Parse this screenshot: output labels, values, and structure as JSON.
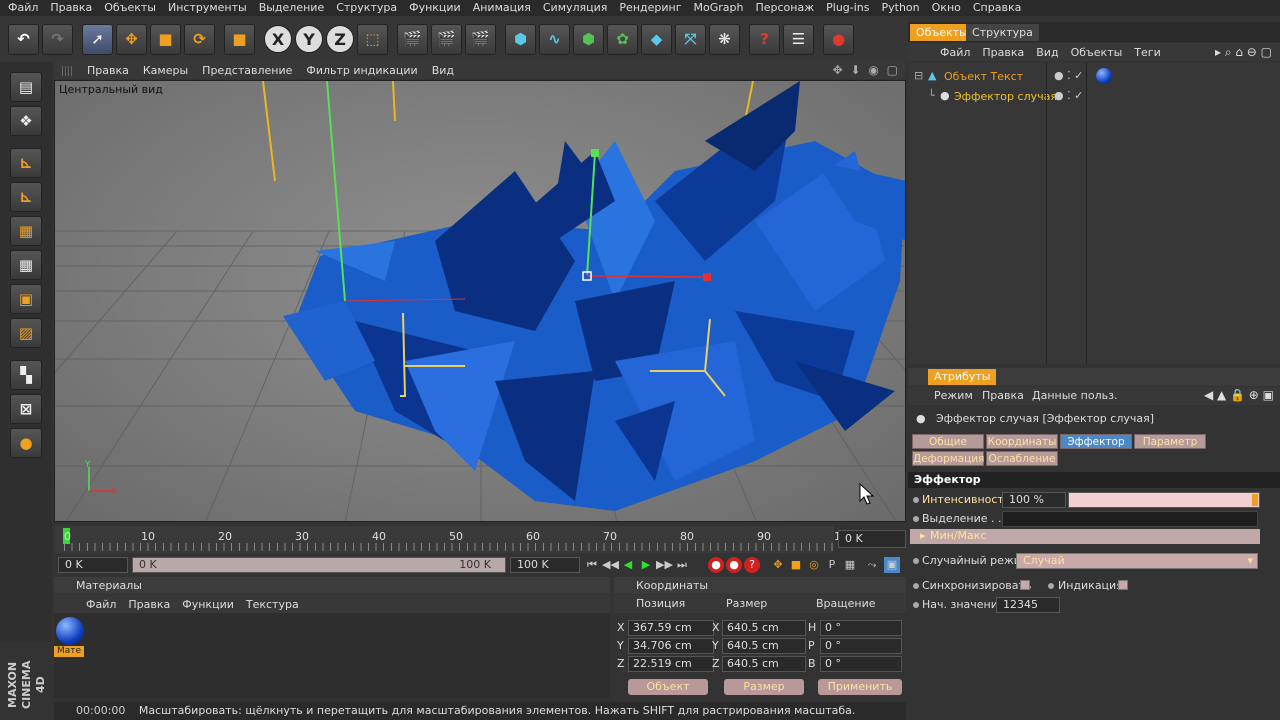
{
  "menubar": [
    "Файл",
    "Правка",
    "Объекты",
    "Инструменты",
    "Выделение",
    "Структура",
    "Функции",
    "Анимация",
    "Симуляция",
    "Рендеринг",
    "MoGraph",
    "Персонаж",
    "Plug-ins",
    "Python",
    "Окно",
    "Справка"
  ],
  "toolbar_icons": [
    "undo-icon",
    "redo-icon",
    "live-select-icon",
    "move-icon",
    "scale-icon",
    "rotate-icon",
    "recent-tool-icon",
    "x-axis-icon",
    "y-axis-icon",
    "z-axis-icon",
    "coordinate-system-icon",
    "render-view-icon",
    "render-picture-viewer-icon",
    "render-settings-icon",
    "cube-icon",
    "spline-pen-icon",
    "subdivision-icon",
    "array-icon",
    "deformer-icon",
    "camera-icon",
    "light-icon",
    "help-icon",
    "script-icon",
    "record-icon"
  ],
  "toolbar_labels": {
    "x": "X",
    "y": "Y",
    "z": "Z"
  },
  "left_tools": [
    "make-editable-icon",
    "model-mode-icon",
    "object-axis-icon",
    "texture-axis-icon",
    "points-mode-icon",
    "edges-mode-icon",
    "polygons-mode-icon",
    "uv-mode-icon",
    "tweak-icon",
    "solo-icon",
    "material-icon"
  ],
  "viewport": {
    "menu": [
      "Правка",
      "Камеры",
      "Представление",
      "Фильтр индикации",
      "Вид"
    ],
    "title": "Центральный вид",
    "nav_icons": "✥ ⬇ ◉ ▢"
  },
  "timeline": {
    "ticks": [
      "0",
      "10",
      "20",
      "30",
      "40",
      "50",
      "60",
      "70",
      "80",
      "90",
      "100"
    ],
    "current_frame": "0 K",
    "start": "0 K",
    "range_start": "0 K",
    "range_end": "100 K",
    "end": "100 K",
    "current_fraction": 0.0
  },
  "materials": {
    "title": "Материалы",
    "menu": [
      "Файл",
      "Правка",
      "Функции",
      "Текстура"
    ],
    "items": [
      {
        "label": "Мате"
      }
    ]
  },
  "coordinates": {
    "title": "Координаты",
    "columns": [
      "Позиция",
      "Размер",
      "Вращение"
    ],
    "rows": [
      {
        "axis": "X",
        "pos": "367.59 cm",
        "size_axis": "X",
        "size": "640.5 cm",
        "rot_axis": "H",
        "rot": "0 °"
      },
      {
        "axis": "Y",
        "pos": "34.706 cm",
        "size_axis": "Y",
        "size": "640.5 cm",
        "rot_axis": "P",
        "rot": "0 °"
      },
      {
        "axis": "Z",
        "pos": "22.519 cm",
        "size_axis": "Z",
        "size": "640.5 cm",
        "rot_axis": "B",
        "rot": "0 °"
      }
    ],
    "btn_object": "Объект",
    "btn_size": "Размер",
    "btn_apply": "Применить"
  },
  "status": {
    "time": "00:00:00",
    "message": "Масштабировать: щёлкнуть и перетащить для масштабирования элементов. Нажать SHIFT для растрирования масштаба."
  },
  "object_manager": {
    "tabs": [
      "Объекты",
      "Структура"
    ],
    "menu": [
      "Файл",
      "Правка",
      "Вид",
      "Объекты",
      "Теги"
    ],
    "objects": [
      {
        "name": "Объект Текст"
      },
      {
        "name": "Эффектор случая"
      }
    ]
  },
  "attributes": {
    "title": "Атрибуты",
    "menu": [
      "Режим",
      "Правка",
      "Данные польз."
    ],
    "object_title": "Эффектор случая [Эффектор случая]",
    "tabs_row1": [
      "Общие",
      "Координаты",
      "Эффектор",
      "Параметр"
    ],
    "tabs_row2": [
      "Деформация",
      "Ослабление"
    ],
    "selected_tab": "Эффектор",
    "section": "Эффектор",
    "intensity_label": "Интенсивность",
    "intensity_value": "100 %",
    "intensity_fraction": 1.0,
    "selection_label": "Выделение . . .",
    "minmax_label": "Мин/Макс",
    "random_mode_label": "Случайный режим",
    "random_mode_value": "Случай",
    "sync_label": "Синхронизировать",
    "indication_label": "Индикация",
    "seed_label": "Нач. значение",
    "seed_value": "12345"
  },
  "brand": "MAXON CINEMA 4D",
  "colors": {
    "accent_orange": "#f0a020",
    "selected_tab": "#4a88c8",
    "shards": "#1a5cc8"
  }
}
